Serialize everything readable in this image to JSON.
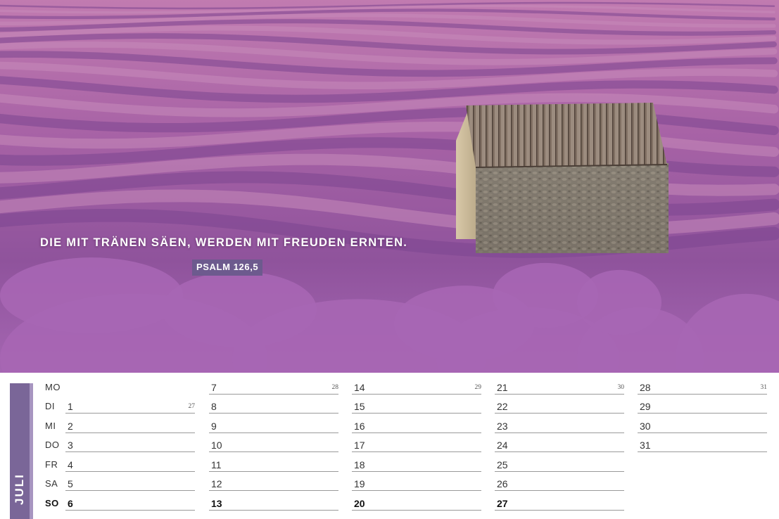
{
  "quote": {
    "text": "DIE MIT TRÄNEN SÄEN, WERDEN MIT FREUDEN ERNTEN.",
    "source": "PSALM 126,5"
  },
  "photo": {
    "description_colors": {
      "lavender": "#9b59a8",
      "roof": "#7d6a5e",
      "stone": "#8c8274"
    }
  },
  "calendar": {
    "month": "JULI",
    "accent_color": "#7a6698",
    "weekdays": [
      "MO",
      "DI",
      "MI",
      "DO",
      "FR",
      "SA",
      "SO"
    ],
    "weeks": [
      {
        "kw": "27",
        "days": [
          "",
          "1",
          "2",
          "3",
          "4",
          "5",
          "6"
        ]
      },
      {
        "kw": "28",
        "days": [
          "7",
          "8",
          "9",
          "10",
          "11",
          "12",
          "13"
        ]
      },
      {
        "kw": "29",
        "days": [
          "14",
          "15",
          "16",
          "17",
          "18",
          "19",
          "20"
        ]
      },
      {
        "kw": "30",
        "days": [
          "21",
          "22",
          "23",
          "24",
          "25",
          "26",
          "27"
        ]
      },
      {
        "kw": "31",
        "days": [
          "28",
          "29",
          "30",
          "31",
          "",
          "",
          ""
        ]
      }
    ]
  }
}
